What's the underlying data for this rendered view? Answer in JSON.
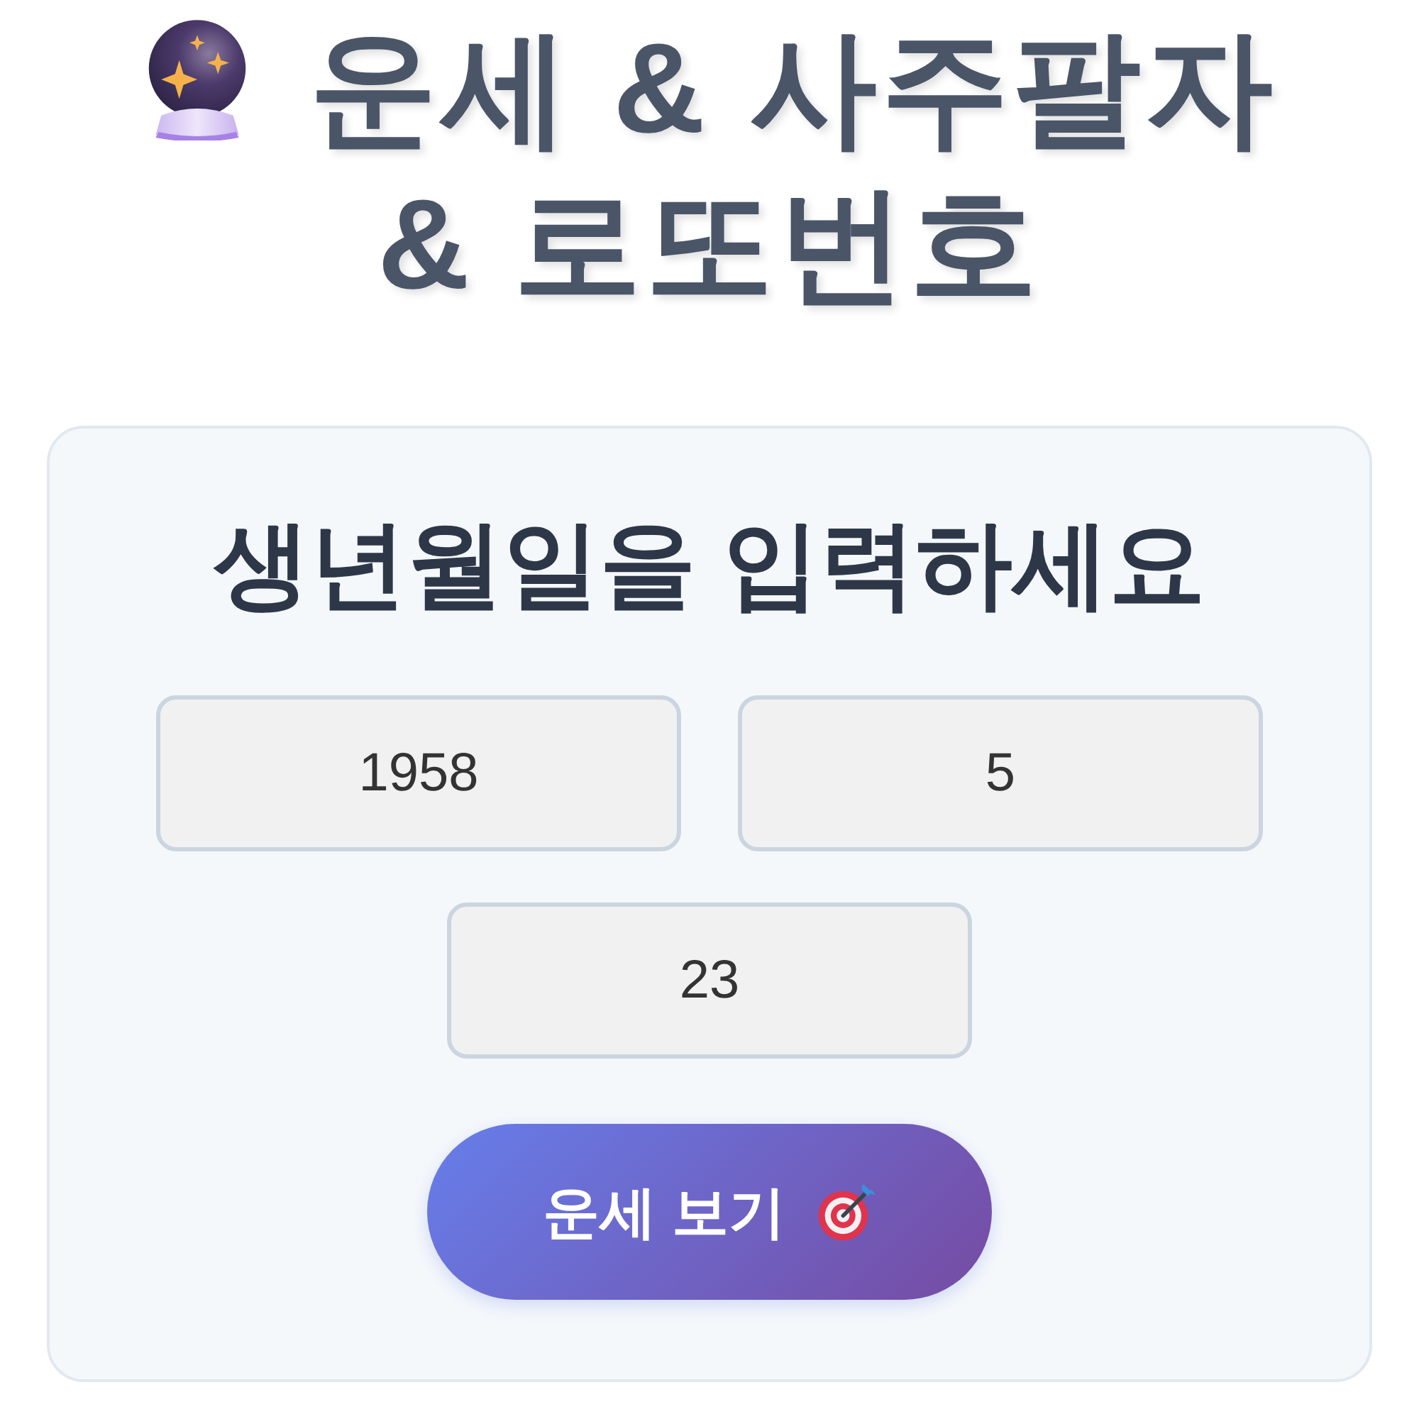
{
  "title": "운세 & 사주팔자 & 로또번호",
  "form": {
    "heading": "생년월일을 입력하세요",
    "fields": [
      {
        "value": "1958"
      },
      {
        "value": "5"
      },
      {
        "value": "23"
      }
    ],
    "submit_button": {
      "label": "운세 보기"
    }
  }
}
